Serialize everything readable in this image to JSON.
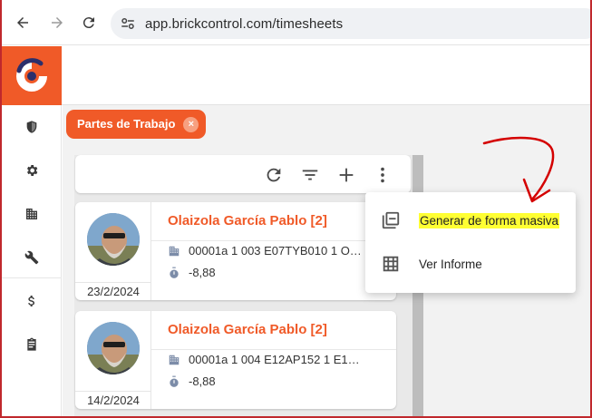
{
  "browser": {
    "url": "app.brickcontrol.com/timesheets",
    "back_icon": "arrow-left-icon",
    "forward_icon": "arrow-right-icon",
    "reload_icon": "reload-icon"
  },
  "colors": {
    "brand": "#f05a28",
    "highlight": "#ffff33",
    "annotation": "#d40000"
  },
  "sidebar": {
    "items": [
      {
        "icon": "shield-icon"
      },
      {
        "icon": "gear-icon"
      },
      {
        "icon": "building-icon"
      },
      {
        "icon": "wrench-icon"
      },
      {
        "icon": "dollar-icon"
      },
      {
        "icon": "clipboard-icon"
      }
    ]
  },
  "tab": {
    "label": "Partes de Trabajo",
    "close": "×"
  },
  "toolbar": {
    "icons": [
      "refresh-icon",
      "filter-icon",
      "add-icon",
      "more-vert-icon"
    ],
    "add_label": "+"
  },
  "cards": [
    {
      "name": "Olaizola García Pablo [2]",
      "code": "00001a 1 003 E07TYB010 1 O…",
      "hours": "-8,88",
      "date": "23/2/2024"
    },
    {
      "name": "Olaizola García Pablo [2]",
      "code": "00001a 1 004 E12AP152 1 E1…",
      "hours": "-8,88",
      "date": "14/2/2024"
    }
  ],
  "menu": {
    "items": [
      {
        "label": "Generar de forma masiva",
        "icon": "library-add-icon",
        "highlighted": true
      },
      {
        "label": "Ver Informe",
        "icon": "grid-icon",
        "highlighted": false
      }
    ]
  }
}
